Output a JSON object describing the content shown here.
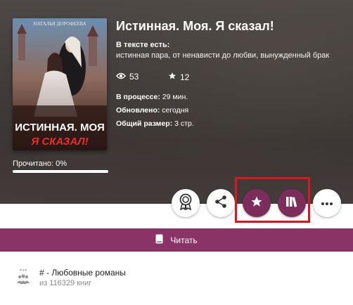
{
  "book": {
    "title": "Истинная. Моя. Я сказал!",
    "cover": {
      "author": "НАТАЛЬЯ ДОРОФЕЕВА",
      "title_line1": "ИСТИННАЯ. МОЯ",
      "title_line2": "Я СКАЗАЛ!"
    },
    "tags_label": "В тексте есть:",
    "tags_value": "истинная пара, от ненависти до любви, вынужденный брак",
    "views": "53",
    "stars": "12",
    "meta": [
      {
        "label": "В процессе:",
        "value": " 29 мин."
      },
      {
        "label": "Обновлено:",
        "value": " сегодня"
      },
      {
        "label": "Общий размер:",
        "value": " 3 стр."
      }
    ],
    "progress": {
      "label": "Прочитано: 0%",
      "percent": 0
    }
  },
  "actions": [
    {
      "name": "award-button",
      "icon": "award-icon"
    },
    {
      "name": "share-button",
      "icon": "share-icon"
    },
    {
      "name": "favorite-button",
      "icon": "star-icon"
    },
    {
      "name": "library-button",
      "icon": "library-icon"
    },
    {
      "name": "more-button",
      "icon": "more-dots-icon"
    }
  ],
  "read_button": {
    "label": "Читать",
    "icon": "book-icon"
  },
  "genre": {
    "title": "# - Любовные романы",
    "subtitle": "из 116329 книг",
    "icon": "rank-icon"
  },
  "colors": {
    "accent": "#7c2d5a",
    "read_bar": "#8a3366",
    "highlight": "#e0141b"
  }
}
